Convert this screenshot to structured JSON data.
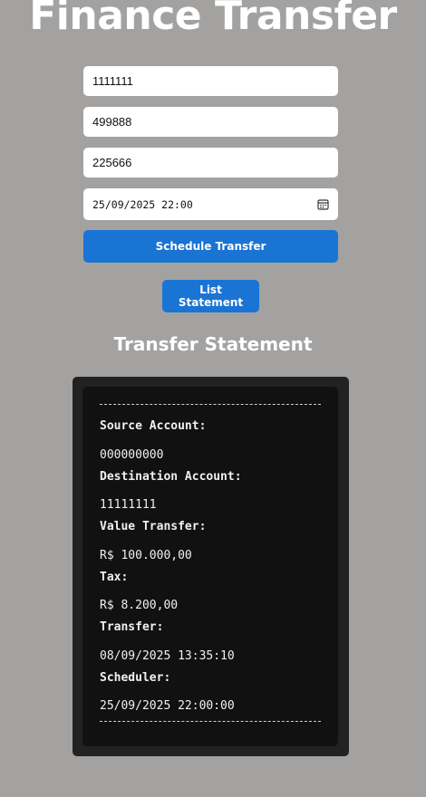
{
  "app": {
    "title": "Finance Transfer"
  },
  "form": {
    "source_account": "1111111",
    "destination_account": "499888",
    "value": "225666",
    "schedule_datetime": "25/09/2025 22:00",
    "schedule_button": "Schedule Transfer",
    "list_button": "List Statement"
  },
  "statement": {
    "title": "Transfer Statement",
    "separator": "----------------------------------------",
    "entries": [
      {
        "label": "Source Account:",
        "value": "000000000"
      },
      {
        "label": "Destination Account:",
        "value": "11111111"
      },
      {
        "label": "Value Transfer:",
        "value": "R$ 100.000,00"
      },
      {
        "label": "Tax:",
        "value": "R$ 8.200,00"
      },
      {
        "label": "Transfer:",
        "value": "08/09/2025 13:35:10"
      },
      {
        "label": "Scheduler:",
        "value": "25/09/2025 22:00:00"
      }
    ]
  },
  "icons": {
    "calendar": "calendar-icon"
  }
}
